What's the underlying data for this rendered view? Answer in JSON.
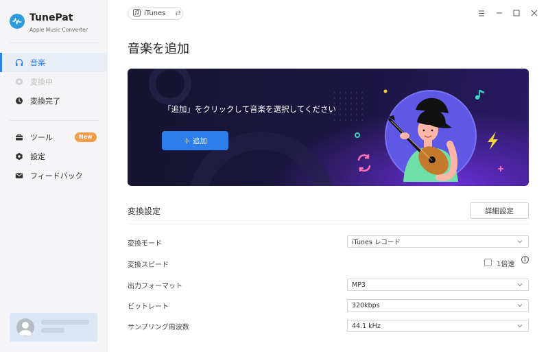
{
  "app": {
    "name": "TunePat",
    "subtitle": "Apple Music Converter"
  },
  "sidebar": {
    "items": [
      {
        "label": "音楽",
        "icon": "headphones-icon",
        "state": "active"
      },
      {
        "label": "変換中",
        "icon": "converting-icon",
        "state": "disabled"
      },
      {
        "label": "変換完了",
        "icon": "clock-icon",
        "state": "normal"
      },
      {
        "label": "ツール",
        "icon": "toolbox-icon",
        "state": "normal",
        "badge": "New"
      },
      {
        "label": "設定",
        "icon": "gear-icon",
        "state": "normal"
      },
      {
        "label": "フィードバック",
        "icon": "mail-icon",
        "state": "normal"
      }
    ]
  },
  "topbar": {
    "source": "iTunes",
    "source_icon": "music-note-icon",
    "swap_icon": "swap-icon"
  },
  "page_title": "音楽を追加",
  "banner": {
    "text": "「追加」をクリックして音楽を選択してください",
    "add_button": "＋ 追加"
  },
  "settings": {
    "title": "変換設定",
    "detail_button": "詳細設定",
    "rows": [
      {
        "label": "変換モード",
        "value": "iTunes レコード"
      },
      {
        "label": "変換スピード",
        "value": "1倍速"
      },
      {
        "label": "出力フォーマット",
        "value": "MP3"
      },
      {
        "label": "ビットレート",
        "value": "320kbps"
      },
      {
        "label": "サンプリング周波数",
        "value": "44.1 kHz"
      }
    ]
  },
  "colors": {
    "accent": "#2f80ed",
    "badge": "#f39c4a",
    "banner_dark": "#151430",
    "banner_purple": "#6a2ed8"
  }
}
